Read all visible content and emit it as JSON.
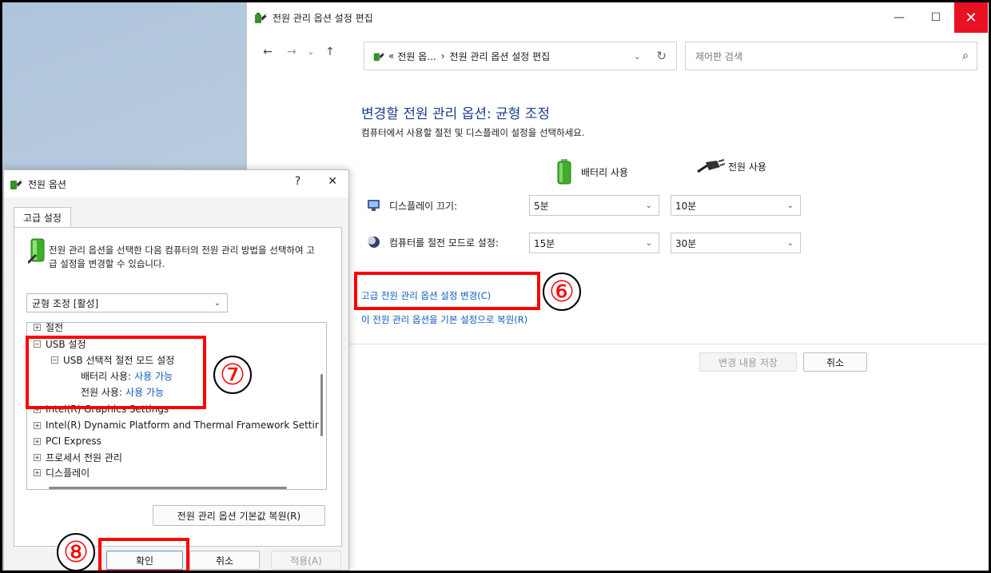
{
  "window": {
    "title": "전원 관리 옵션 설정 편집",
    "address_prefix": "«",
    "address_seg1": "전원 옵...",
    "address_sep": "›",
    "address_seg2": "전원 관리 옵션 설정 편집",
    "search_placeholder": "제어판 검색"
  },
  "plan": {
    "heading": "변경할 전원 관리 옵션: 균형 조정",
    "subheading": "컴퓨터에서 사용할 절전 및 디스플레이 설정을 선택하세요.",
    "col_battery": "배터리 사용",
    "col_plugged": "전원 사용",
    "display_label": "디스플레이 끄기:",
    "display_battery": "5분",
    "display_plugged": "10분",
    "sleep_label": "컴퓨터를 절전 모드로 설정:",
    "sleep_battery": "15분",
    "sleep_plugged": "30분",
    "advanced_link": "고급 전원 관리 옵션 설정 변경(C)",
    "restore_link": "이 전원 관리 옵션을 기본 설정으로 복원(R)",
    "save_button": "변경 내용 저장",
    "cancel_button": "취소"
  },
  "dialog": {
    "title": "전원 옵션",
    "help": "?",
    "close": "✕",
    "tab": "고급 설정",
    "description": "전원 관리 옵션을 선택한 다음 컴퓨터의 전원 관리 방법을 선택하여 고급 설정을 변경할 수 있습니다.",
    "plan_select": "균형 조정 [활성]",
    "tree": {
      "n1": "절전",
      "n2": "USB 설정",
      "n3": "USB 선택적 절전 모드 설정",
      "n4_label": "배터리 사용:",
      "n4_value": "사용 가능",
      "n5_label": "전원 사용:",
      "n5_value": "사용 가능",
      "n6": "Intel(R) Graphics Settings",
      "n7": "Intel(R) Dynamic Platform and Thermal Framework Settir",
      "n8": "PCI Express",
      "n9": "프로세서 전원 관리",
      "n10": "디스플레이"
    },
    "restore_defaults": "전원 관리 옵션 기본값 복원(R)",
    "ok": "확인",
    "cancel": "취소",
    "apply": "적용(A)"
  },
  "annotations": {
    "step6": "⑥",
    "step7": "⑦",
    "step8": "⑧"
  }
}
